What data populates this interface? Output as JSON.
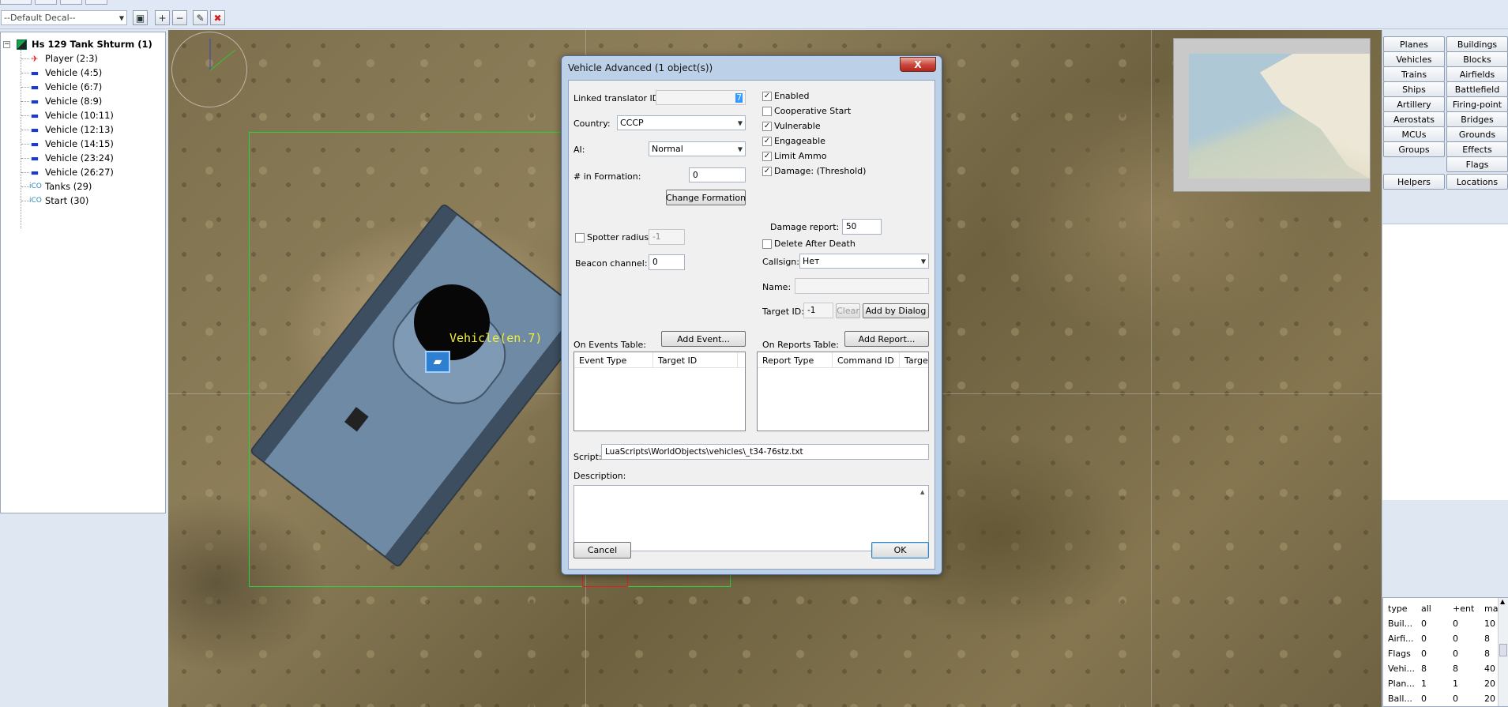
{
  "toolbar": {
    "decal_combo": "--Default Decal--"
  },
  "tree": {
    "root": "Hs 129 Tank Shturm (1)",
    "items": [
      {
        "label": "Player (2:3)",
        "icon": "plane-icon"
      },
      {
        "label": "Vehicle (4:5)",
        "icon": "tank-icon"
      },
      {
        "label": "Vehicle (6:7)",
        "icon": "tank-icon"
      },
      {
        "label": "Vehicle (8:9)",
        "icon": "tank-icon"
      },
      {
        "label": "Vehicle (10:11)",
        "icon": "tank-icon"
      },
      {
        "label": "Vehicle (12:13)",
        "icon": "tank-icon"
      },
      {
        "label": "Vehicle (14:15)",
        "icon": "tank-icon"
      },
      {
        "label": "Vehicle (23:24)",
        "icon": "tank-icon"
      },
      {
        "label": "Vehicle (26:27)",
        "icon": "tank-icon"
      },
      {
        "label": "Tanks (29)",
        "icon": "mcu-icon",
        "icon_text": "iCO"
      },
      {
        "label": "Start (30)",
        "icon": "mcu-icon",
        "icon_text": "iCO"
      }
    ]
  },
  "map": {
    "selected_label": "Vehicle(en.7)"
  },
  "right_panel": {
    "buttons": [
      [
        "Planes",
        "Buildings"
      ],
      [
        "Vehicles",
        "Blocks"
      ],
      [
        "Trains",
        "Airfields"
      ],
      [
        "Ships",
        "Battlefield"
      ],
      [
        "Artillery",
        "Firing-point"
      ],
      [
        "Aerostats",
        "Bridges"
      ],
      [
        "MCUs",
        "Grounds"
      ],
      [
        "Groups",
        "Effects"
      ],
      [
        "",
        "Flags"
      ],
      [
        "Helpers",
        "Locations"
      ]
    ],
    "stats": {
      "headers": [
        "type",
        "all",
        "+ent",
        "ma"
      ],
      "rows": [
        [
          "Buil...",
          "0",
          "0",
          "10"
        ],
        [
          "Airfi...",
          "0",
          "0",
          "8"
        ],
        [
          "Flags",
          "0",
          "0",
          "8"
        ],
        [
          "Vehi...",
          "8",
          "8",
          "40"
        ],
        [
          "Plan...",
          "1",
          "1",
          "20"
        ],
        [
          "Ball...",
          "0",
          "0",
          "20"
        ]
      ]
    }
  },
  "dialog": {
    "title": "Vehicle Advanced (1 object(s))",
    "close": "X",
    "linked_translator_label": "Linked translator ID:",
    "linked_translator_value": "7",
    "country_label": "Country:",
    "country_value": "CCCP",
    "ai_label": "AI:",
    "ai_value": "Normal",
    "formation_label": "# in Formation:",
    "formation_value": "0",
    "change_formation": "Change Formation",
    "spotter_label": "Spotter radius:",
    "spotter_value": "-1",
    "beacon_label": "Beacon channel:",
    "beacon_value": "0",
    "checks": [
      {
        "label": "Enabled",
        "checked": true
      },
      {
        "label": "Cooperative Start",
        "checked": false
      },
      {
        "label": "Vulnerable",
        "checked": true
      },
      {
        "label": "Engageable",
        "checked": true
      },
      {
        "label": "Limit Ammo",
        "checked": true
      },
      {
        "label": "Damage: (Threshold)",
        "checked": true
      }
    ],
    "damage_report_label": "Damage report:",
    "damage_report_value": "50",
    "delete_after_death": "Delete After Death",
    "callsign_label": "Callsign:",
    "callsign_value": "Нет",
    "name_label": "Name:",
    "name_value": "",
    "target_id_label": "Target ID:",
    "target_id_value": "-1",
    "clear": "Clear",
    "add_by_dialog": "Add by Dialog",
    "events_label": "On Events Table:",
    "add_event": "Add Event...",
    "events_cols": [
      "Event Type",
      "Target ID"
    ],
    "reports_label": "On Reports Table:",
    "add_report": "Add Report...",
    "reports_cols": [
      "Report Type",
      "Command ID",
      "Targe"
    ],
    "script_label": "Script:",
    "script_value": "LuaScripts\\WorldObjects\\vehicles\\_t34-76stz.txt",
    "description_label": "Description:",
    "cancel": "Cancel",
    "ok": "OK"
  }
}
